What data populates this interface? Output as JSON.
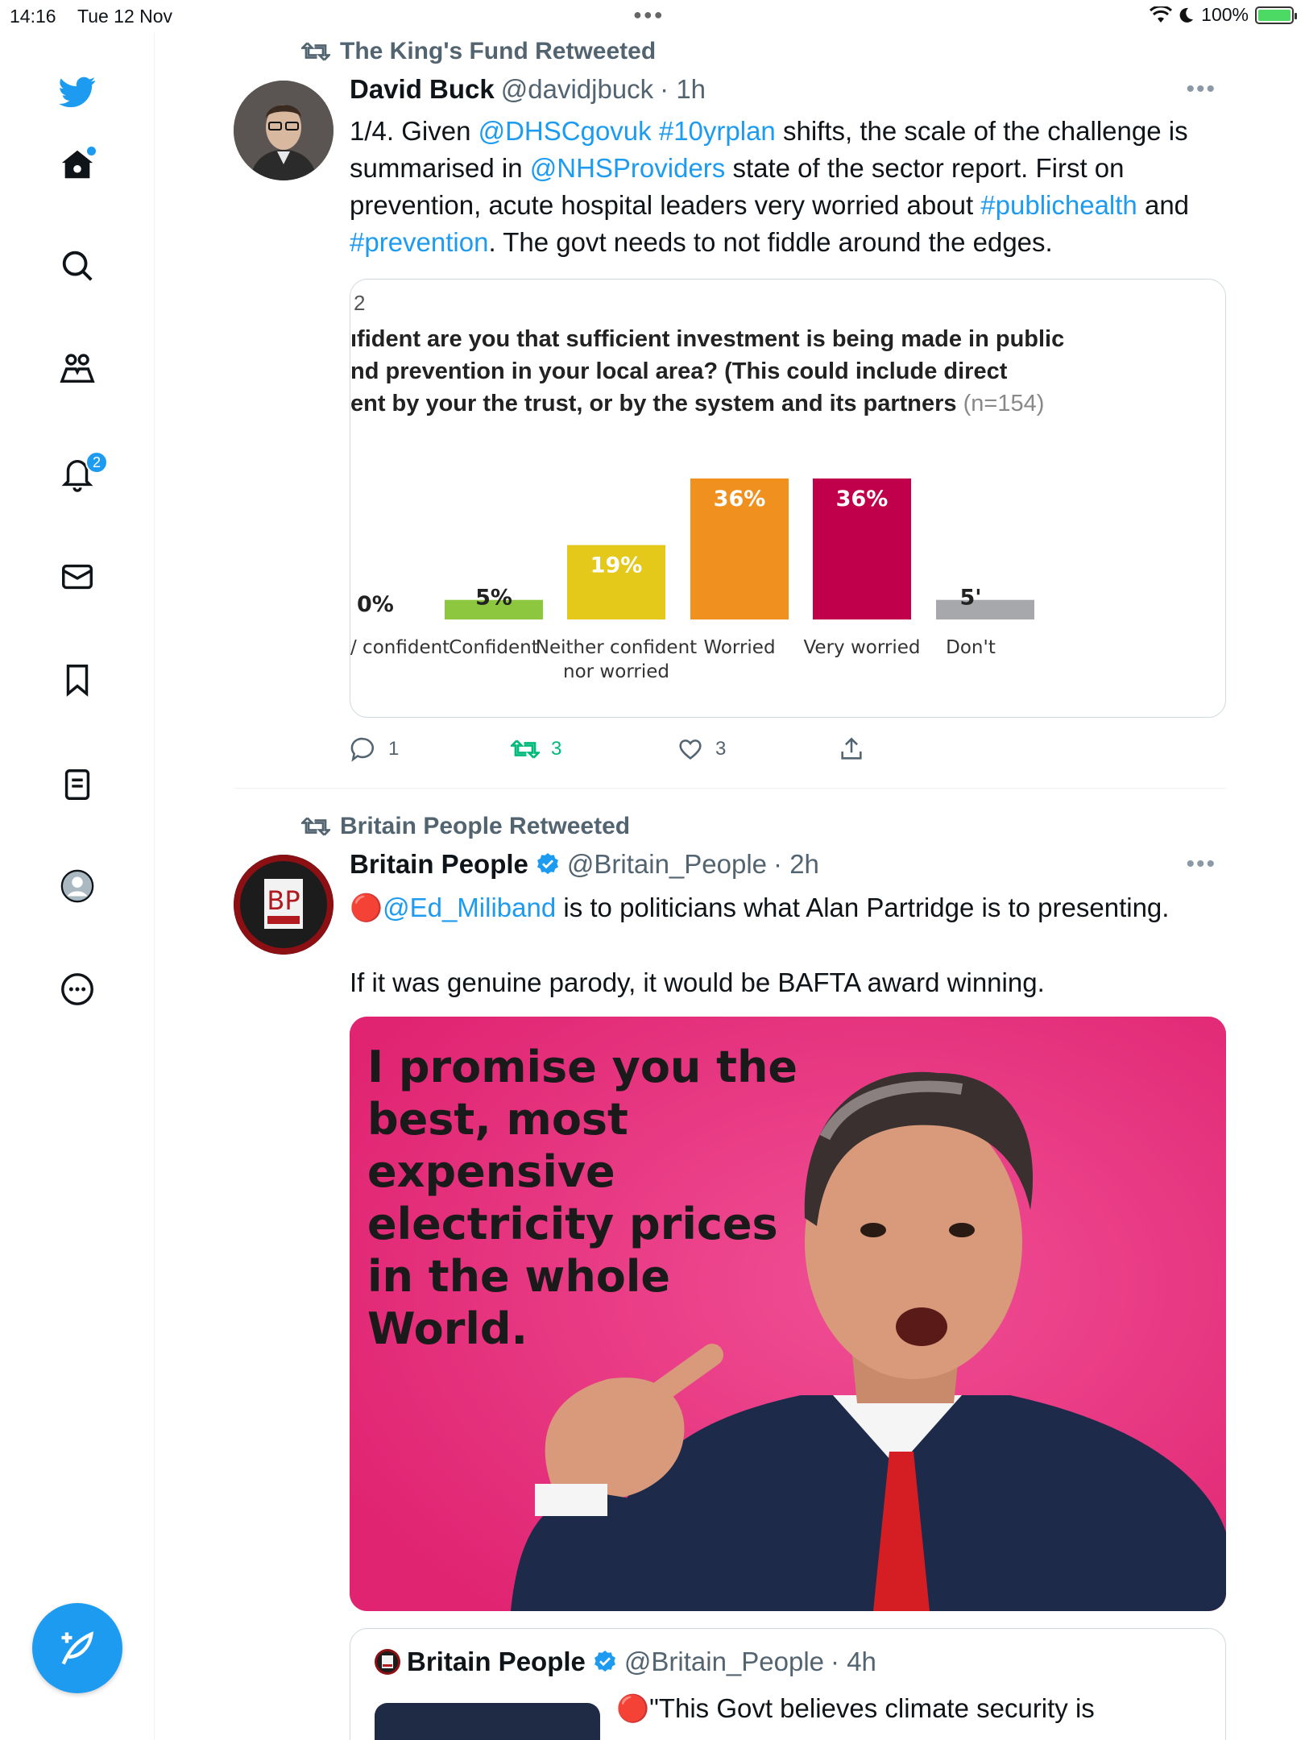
{
  "status": {
    "time": "14:16",
    "date": "Tue 12 Nov",
    "battery": "100%",
    "battery_level": 1.0
  },
  "nav": {
    "notifications_count": "2"
  },
  "tweet1": {
    "retweeted_by": "The King's Fund Retweeted",
    "name": "David Buck",
    "handle": "@davidjbuck",
    "time": "· 1h",
    "text_parts": [
      {
        "t": "1/4. Given ",
        "link": false
      },
      {
        "t": "@DHSCgovuk",
        "link": true
      },
      {
        "t": " ",
        "link": false
      },
      {
        "t": "#10yrplan",
        "link": true
      },
      {
        "t": " shifts, the scale of the challenge is summarised in ",
        "link": false
      },
      {
        "t": "@NHSProviders",
        "link": true
      },
      {
        "t": " state of the sector report.  First on prevention, acute hospital leaders very worried about ",
        "link": false
      },
      {
        "t": "#publichealth",
        "link": true
      },
      {
        "t": " and ",
        "link": false
      },
      {
        "t": "#prevention",
        "link": true
      },
      {
        "t": ". The govt needs to not fiddle around the edges.",
        "link": false
      }
    ],
    "chart_card": {
      "number": "2",
      "question_lines": [
        "ıfident are you that sufficient investment is being made in public",
        "nd prevention in your local area? (This could include direct",
        "ent by your the trust, or by the system and its partners"
      ],
      "sample": "(n=154)"
    },
    "replies": "1",
    "retweets": "3",
    "likes": "3"
  },
  "chart_data": {
    "type": "bar",
    "categories": [
      "/ confident",
      "Confident",
      "Neither confident nor worried",
      "Worried",
      "Very worried",
      "Don't"
    ],
    "values": [
      0,
      5,
      19,
      36,
      36,
      5
    ],
    "value_labels": [
      "0%",
      "5%",
      "19%",
      "36%",
      "36%",
      "5'"
    ],
    "colors": [
      "#8dc63f",
      "#8dc63f",
      "#e4c91a",
      "#f0901e",
      "#c0004b",
      "#a6a8ab"
    ],
    "ylim": [
      0,
      36
    ]
  },
  "tweet2": {
    "retweeted_by": "Britain People Retweeted",
    "name": "Britain People",
    "handle": "@Britain_People",
    "time": "· 2h",
    "line1_emoji": "🔴",
    "line1_link": "@Ed_Miliband",
    "line1_rest": " is to politicians what Alan Partridge is to presenting.",
    "line2": "If it was genuine parody, it would be BAFTA award winning.",
    "avatar_text": "BP",
    "meme_text": "I promise you the best, most expensive electricity prices in the whole World.",
    "quoted": {
      "name": "Britain People",
      "handle": "@Britain_People",
      "time": "· 4h",
      "text": "🔴\"This Govt believes climate security is"
    }
  }
}
